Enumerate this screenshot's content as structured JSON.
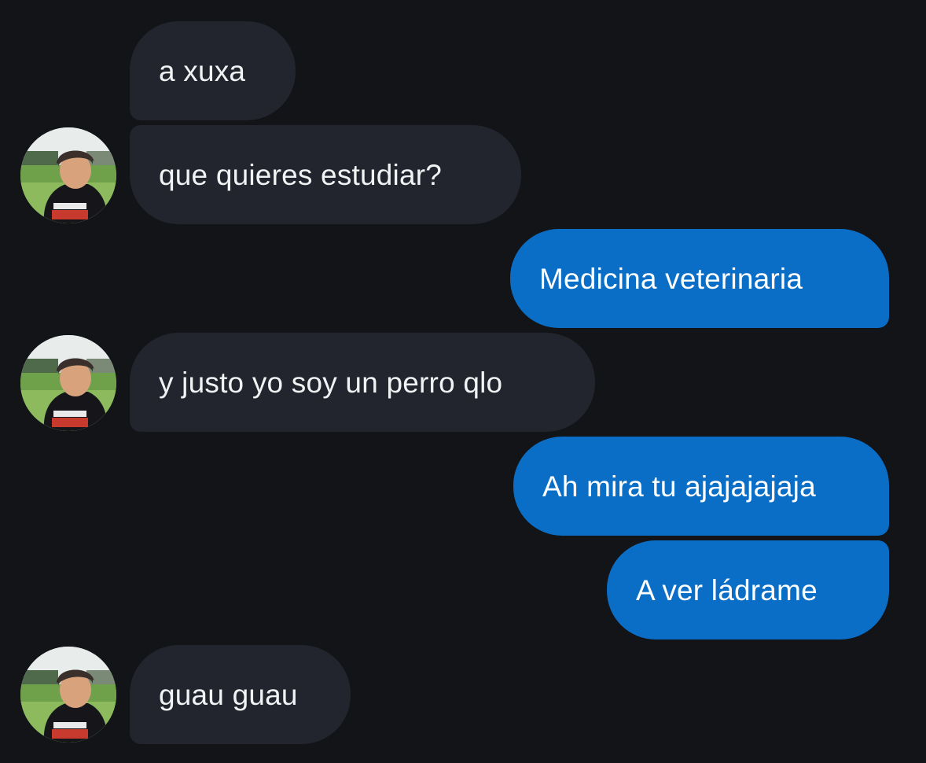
{
  "conversation": {
    "messages": [
      {
        "sender": "contact",
        "text": "a xuxa"
      },
      {
        "sender": "contact",
        "text": "que quieres estudiar?"
      },
      {
        "sender": "me",
        "text": "Medicina veterinaria"
      },
      {
        "sender": "contact",
        "text": "y justo yo soy un perro qlo"
      },
      {
        "sender": "me",
        "text": "Ah mira tu ajajajajaja"
      },
      {
        "sender": "me",
        "text": "A ver ládrame"
      },
      {
        "sender": "contact",
        "text": "guau guau"
      }
    ]
  },
  "colors": {
    "background": "#121418",
    "incoming_bubble": "#22252d",
    "outgoing_bubble": "#0a6ec6",
    "text": "#ffffff"
  },
  "icons": {
    "contact_avatar": "contact-avatar-photo"
  }
}
